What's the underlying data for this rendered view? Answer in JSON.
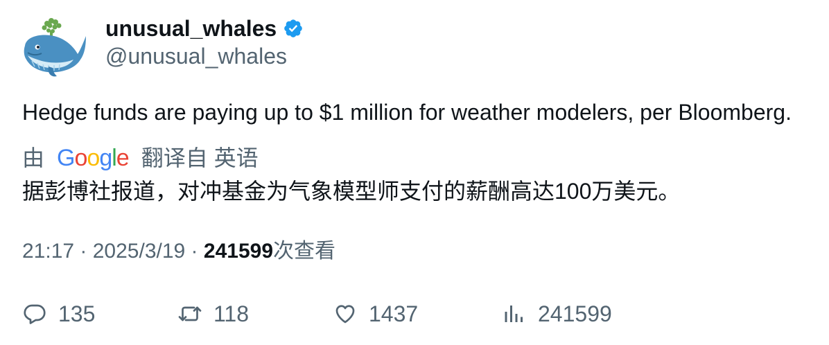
{
  "author": {
    "display_name": "unusual_whales",
    "handle": "@unusual_whales",
    "verified_icon": "verified-badge-icon",
    "avatar_icon": "whale-avatar"
  },
  "tweet": {
    "text": "Hedge funds are paying up to $1 million for weather modelers, per Bloomberg."
  },
  "translation": {
    "by_label": "由",
    "provider_logo": "Google",
    "from_label": "翻译自 英语",
    "text": "据彭博社报道，对冲基金为气象模型师支付的薪酬高达100万美元。"
  },
  "meta": {
    "time": "21:17",
    "sep1": " · ",
    "date": "2025/3/19",
    "sep2": " · ",
    "views_count": "241599",
    "views_label": "次查看"
  },
  "actions": {
    "replies": "135",
    "retweets": "118",
    "likes": "1437",
    "views": "241599"
  },
  "colors": {
    "text_primary": "#0f1419",
    "text_secondary": "#536471",
    "verified_blue": "#1d9bf0"
  }
}
